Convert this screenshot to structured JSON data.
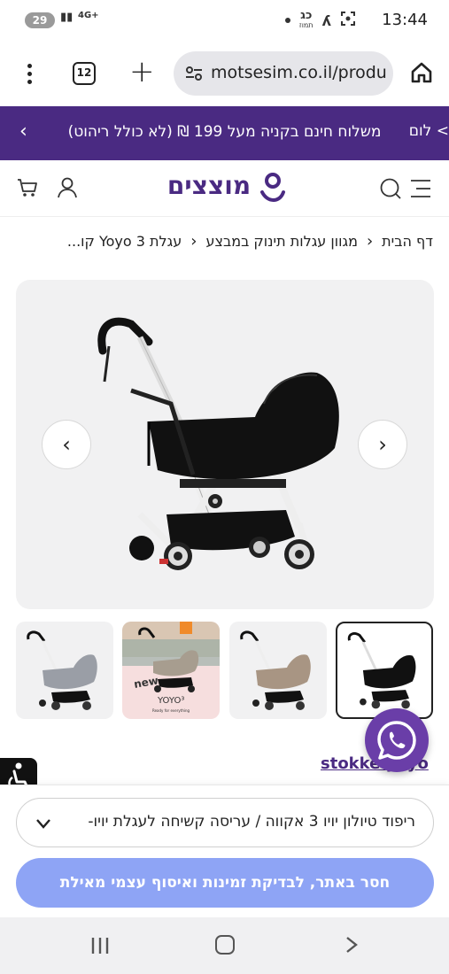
{
  "status_bar": {
    "time": "13:44",
    "battery": "29",
    "network": "4G+",
    "hebrew_date": "כג",
    "hebrew_month": "תמוז"
  },
  "browser": {
    "tab_count": "12",
    "url": "motsesim.co.il/produ"
  },
  "promo": {
    "text": "משלוח חינם בקניה מעל 199 ₪ (לא כולל ריהוט)",
    "next_text": "לום <"
  },
  "header": {
    "logo_text": "מוצצים",
    "brand_color": "#4a2a82"
  },
  "breadcrumb": {
    "items": [
      "דף הבית",
      "מגוון עגלות תינוק במבצע",
      "עגלת Yoyo 3 קו..."
    ]
  },
  "gallery": {
    "thumbnails": [
      {
        "name": "black-bassinet",
        "active": true
      },
      {
        "name": "taupe-bassinet",
        "active": false
      },
      {
        "name": "yoyo3-promo",
        "active": false,
        "caption_new": "new",
        "caption_brand": "YOYO³",
        "caption_tag": "Ready for everything"
      },
      {
        "name": "grey-bassinet",
        "active": false
      }
    ]
  },
  "brand_link": {
    "text": "stokke yoyo"
  },
  "sheet": {
    "select_value": "ריפוד טיולון יויו 3 אקווה / עריסה קשיחה לעגלת יויו-",
    "cta_label": "חסר באתר, לבדיקת זמינות ואיסוף עצמי מאילת",
    "cta_color": "#8ea4f5"
  },
  "icons": [
    "kebab-icon",
    "plus-icon",
    "site-settings-icon",
    "home-icon",
    "menu-icon",
    "search-icon",
    "user-icon",
    "cart-icon",
    "whatsapp-icon",
    "accessibility-icon"
  ]
}
